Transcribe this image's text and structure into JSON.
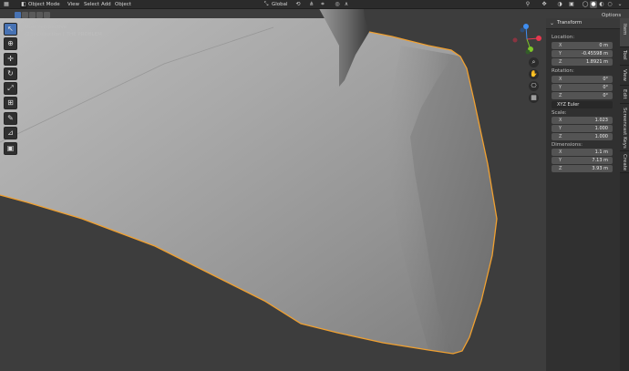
{
  "header": {
    "mode": "Object Mode",
    "menus": [
      "View",
      "Select",
      "Add",
      "Object"
    ],
    "orientation": "Global",
    "options": "Options"
  },
  "overlay": {
    "view_name": "User Perspective",
    "collection": "(23) Collection | THE PROBLEM"
  },
  "toolbar": {
    "tools": [
      "select-box",
      "cursor",
      "move",
      "rotate",
      "scale",
      "transform",
      "annotate",
      "measure",
      "add-cube"
    ]
  },
  "gizmo": {
    "axes": [
      "X",
      "Y",
      "Z"
    ],
    "colors": {
      "x": "#e8384f",
      "y": "#7ec629",
      "z": "#3f8ef2"
    }
  },
  "panel": {
    "title": "Transform",
    "location_label": "Location:",
    "location": [
      {
        "axis": "X",
        "value": "0 m"
      },
      {
        "axis": "Y",
        "value": "-0.45598 m"
      },
      {
        "axis": "Z",
        "value": "1.8921 m"
      }
    ],
    "rotation_label": "Rotation:",
    "rotation": [
      {
        "axis": "X",
        "value": "0°"
      },
      {
        "axis": "Y",
        "value": "0°"
      },
      {
        "axis": "Z",
        "value": "0°"
      }
    ],
    "rotation_mode": "XYZ Euler",
    "scale_label": "Scale:",
    "scale": [
      {
        "axis": "X",
        "value": "1.023"
      },
      {
        "axis": "Y",
        "value": "1.000"
      },
      {
        "axis": "Z",
        "value": "1.000"
      }
    ],
    "dimensions_label": "Dimensions:",
    "dimensions": [
      {
        "axis": "X",
        "value": "1.1 m"
      },
      {
        "axis": "Y",
        "value": "7.13 m"
      },
      {
        "axis": "Z",
        "value": "3.93 m"
      }
    ]
  },
  "tabs": [
    "Item",
    "Tool",
    "View",
    "Edit",
    "Screencast Keys",
    "Create"
  ],
  "colors": {
    "selection_outline": "#f0a030",
    "active_blue": "#4772b3"
  }
}
